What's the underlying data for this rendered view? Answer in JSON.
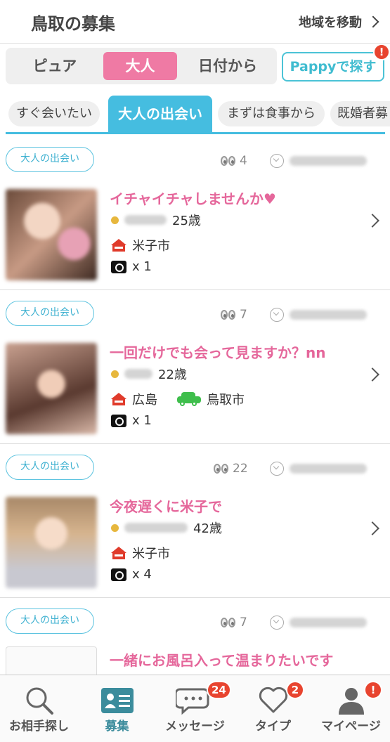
{
  "header": {
    "title": "鳥取の募集",
    "region_label": "地域を移動"
  },
  "segments": [
    "ピュア",
    "大人",
    "日付から"
  ],
  "active_segment": "大人",
  "pappy": {
    "label": "Pappyで探す",
    "badge": "!"
  },
  "categories": [
    "すぐ会いたい",
    "大人の出会い",
    "まずは食事から",
    "既婚者募"
  ],
  "active_category": "大人の出会い",
  "posts": [
    {
      "tag": "大人の出会い",
      "views": "4",
      "title": "イチャイチャしませんか♥",
      "age": "25歳",
      "location": "米子市",
      "destination": "",
      "photos": "x 1"
    },
    {
      "tag": "大人の出会い",
      "views": "7",
      "title": "一回だけでも会って見ますか？nn",
      "age": "22歳",
      "location": "広島",
      "destination": "鳥取市",
      "photos": "x 1"
    },
    {
      "tag": "大人の出会い",
      "views": "22",
      "title": "今夜遅くに米子で",
      "age": "42歳",
      "location": "米子市",
      "destination": "",
      "photos": "x 4"
    },
    {
      "tag": "大人の出会い",
      "views": "7",
      "title": "一緒にお風呂入って温まりたいです"
    }
  ],
  "nav": {
    "items": [
      {
        "label": "お相手探し",
        "icon": "search-icon"
      },
      {
        "label": "募集",
        "icon": "board-icon"
      },
      {
        "label": "メッセージ",
        "icon": "message-icon",
        "badge": "24"
      },
      {
        "label": "タイプ",
        "icon": "heart-icon",
        "badge": "2"
      },
      {
        "label": "マイページ",
        "icon": "person-icon",
        "badge": "!"
      }
    ]
  },
  "colors": {
    "accent_pink": "#ef7aa4",
    "accent_blue": "#45bde0",
    "badge_red": "#e8442f"
  }
}
